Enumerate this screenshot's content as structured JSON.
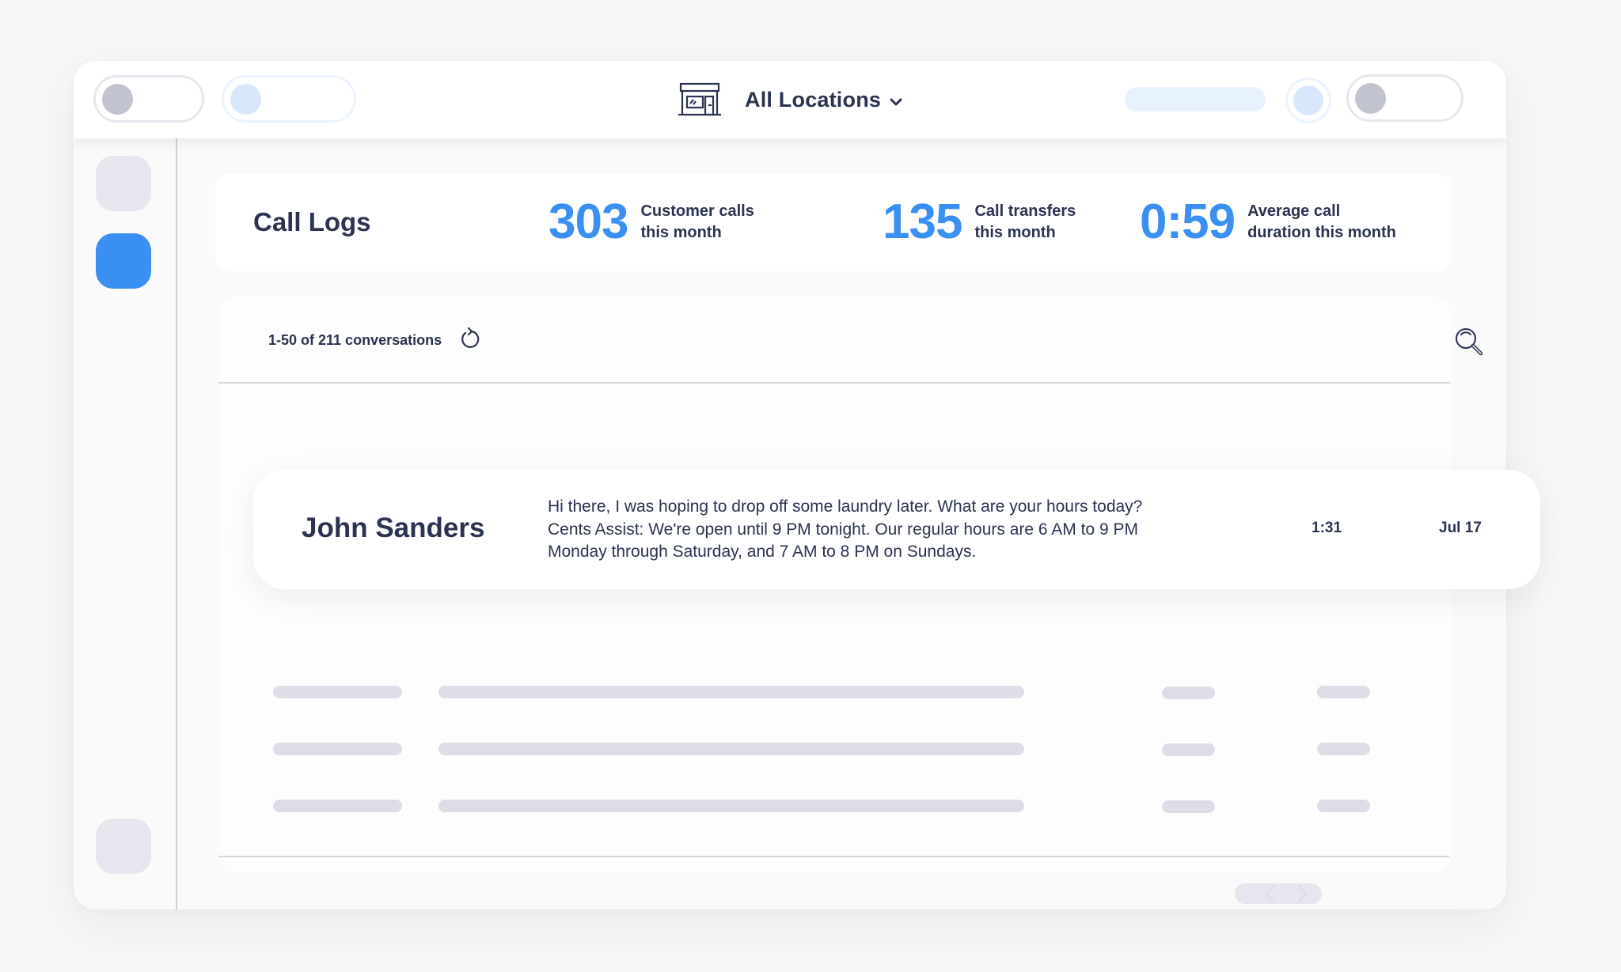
{
  "header": {
    "location_label": "All Locations",
    "location_icon": "storefront-icon",
    "dropdown_icon": "chevron-down-icon"
  },
  "stats": {
    "title": "Call Logs",
    "items": [
      {
        "value": "303",
        "label_line1": "Customer calls",
        "label_line2": "this month"
      },
      {
        "value": "135",
        "label_line1": "Call transfers",
        "label_line2": "this month"
      },
      {
        "value": "0:59",
        "label_line1": "Average call",
        "label_line2": "duration this month"
      }
    ]
  },
  "list": {
    "count_text": "1-50 of 211 conversations",
    "refresh_icon": "refresh-icon",
    "search_icon": "search-icon",
    "highlighted_row": {
      "name": "John Sanders",
      "message_line1": "Hi there, I was hoping to drop off some laundry later. What are your hours today?",
      "message_line2": "Cents Assist: We're open until 9 PM tonight. Our regular hours are 6 AM to 9 PM",
      "message_line3": "Monday through Saturday, and 7 AM to 8 PM on Sundays.",
      "duration": "1:31",
      "date": "Jul 17"
    },
    "pagination": {
      "prev_icon": "chevron-left-icon",
      "next_icon": "chevron-right-icon"
    }
  },
  "colors": {
    "accent": "#3a8ff2",
    "text": "#2b3350",
    "skeleton": "#dcdde6",
    "sidebar_inactive": "#e6e6ee"
  }
}
